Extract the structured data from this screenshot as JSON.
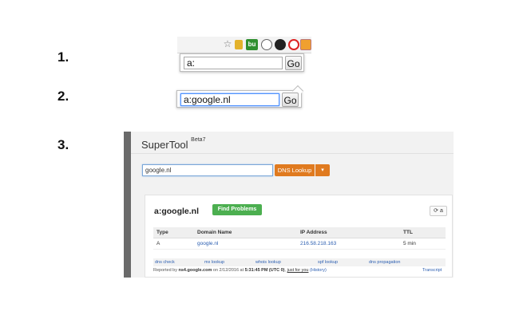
{
  "steps": [
    "1.",
    "2.",
    "3."
  ],
  "step1": {
    "extension_icons": [
      "star-icon",
      "lock-icon",
      "bu-icon",
      "timer-icon",
      "dark-circle-icon",
      "opera-icon",
      "supertool-icon"
    ],
    "bu_label": "bu",
    "input_value": "a:",
    "go_label": "Go"
  },
  "step2": {
    "input_value": "a:google.nl",
    "go_label": "Go"
  },
  "supertool": {
    "brand": "SuperTool",
    "beta": "Beta7",
    "query_value": "google.nl",
    "dns_button": "DNS Lookup",
    "dns_caret": "▾",
    "result_title": "a:google.nl",
    "find_problems_button": "Find Problems",
    "refresh_label": "⟳ a",
    "table": {
      "headers": [
        "Type",
        "Domain Name",
        "IP Address",
        "TTL"
      ],
      "rows": [
        [
          "A",
          "google.nl",
          "216.58.218.163",
          "5 min"
        ]
      ]
    },
    "tools": [
      "dns check",
      "mx lookup",
      "whois lookup",
      "spf lookup",
      "dns propagation"
    ],
    "footer": {
      "reported_by": "Reported by",
      "server": "ns4.google.com",
      "on": "on 2/12/2016 at",
      "time": "5:31:45 PM (UTC 0)",
      "just_for_you": "just for you",
      "history": "(History)",
      "transcript": "Transcript"
    }
  },
  "colors": {
    "dns_button": "#e07a1f",
    "find_problems": "#4caf50",
    "link": "#2a5db0",
    "panel_border": "#6a6a6a"
  }
}
